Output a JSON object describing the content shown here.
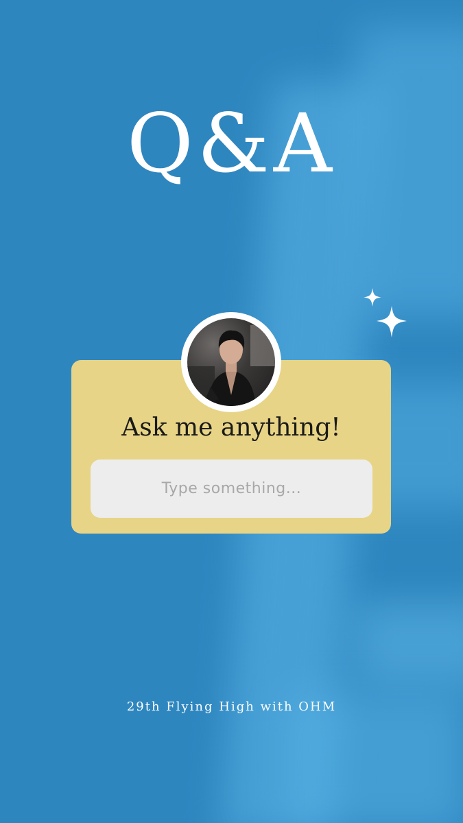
{
  "header": {
    "title": "Q&A"
  },
  "card": {
    "heading": "Ask me anything!",
    "input": {
      "value": "",
      "placeholder": "Type something..."
    },
    "avatar_icon": "profile-photo"
  },
  "decoration": {
    "sparkle_icon": "sparkle-icon"
  },
  "footer": {
    "caption": "29th Flying High with OHM"
  },
  "colors": {
    "background": "#2e86bf",
    "card": "#e8d486",
    "input": "#ededed",
    "text_light": "#ffffff",
    "text_dark": "#1a1a1a"
  }
}
